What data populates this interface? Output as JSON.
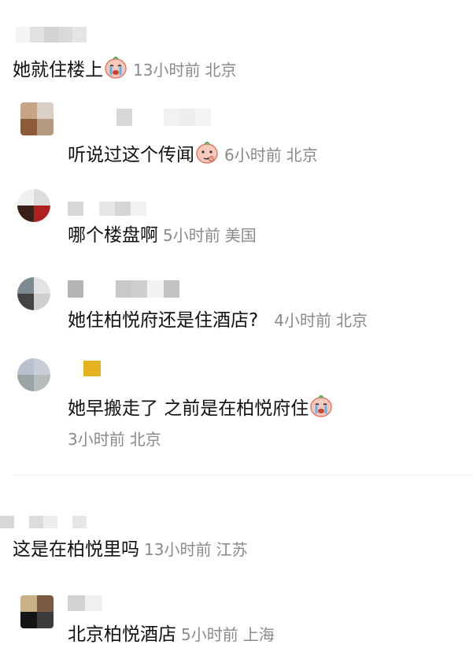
{
  "colors": {
    "text": "#111111",
    "meta": "#8a8a8a",
    "divider": "#ececec",
    "background": "#ffffff"
  },
  "comments": [
    {
      "text": "她就住楼上",
      "emoji": "crying-face-emoji",
      "time": "13小时前",
      "location": "北京",
      "replies": [
        {
          "text": "听说过这个传闻",
          "emoji": "thinking-face-emoji",
          "time": "6小时前",
          "location": "北京"
        },
        {
          "text": "哪个楼盘啊",
          "time": "5小时前",
          "location": "美国"
        },
        {
          "text": "她住柏悦府还是住酒店?",
          "time": "4小时前",
          "location": "北京"
        },
        {
          "text": "她早搬走了 之前是在柏悦府住",
          "emoji": "crying-face-emoji",
          "time": "3小时前",
          "location": "北京"
        }
      ]
    },
    {
      "text": "这是在柏悦里吗",
      "time": "13小时前",
      "location": "江苏",
      "replies": [
        {
          "text": "北京柏悦酒店",
          "time": "5小时前",
          "location": "上海"
        }
      ]
    }
  ]
}
